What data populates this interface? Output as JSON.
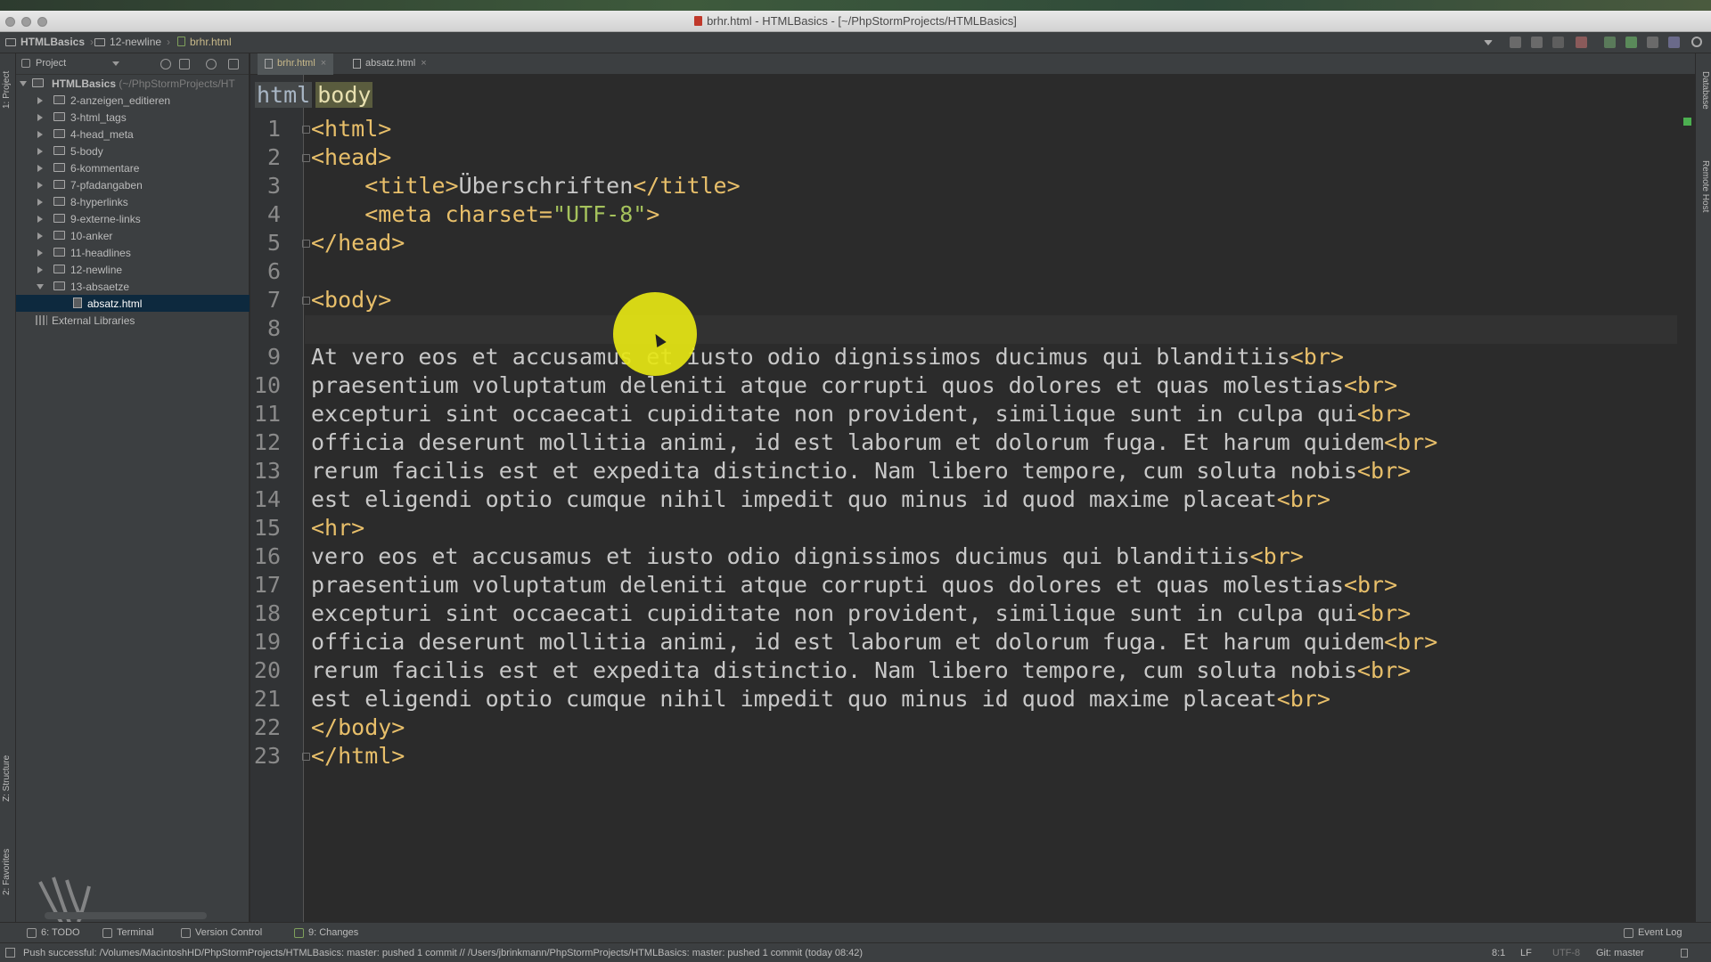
{
  "window": {
    "title": "brhr.html - HTMLBasics - [~/PhpStormProjects/HTMLBasics]"
  },
  "nav": {
    "crumbs": [
      "HTMLBasics",
      "12-newline",
      "brhr.html"
    ]
  },
  "side_tabs": {
    "project": "1: Project",
    "structure": "Z: Structure",
    "favorites": "2: Favorites",
    "database": "Database",
    "remote_host": "Remote Host"
  },
  "project_panel": {
    "title": "Project",
    "root": {
      "label": "HTMLBasics",
      "path": "(~/PhpStormProjects/HT"
    },
    "items": [
      {
        "label": "2-anzeigen_editieren"
      },
      {
        "label": "3-html_tags"
      },
      {
        "label": "4-head_meta"
      },
      {
        "label": "5-body"
      },
      {
        "label": "6-kommentare"
      },
      {
        "label": "7-pfadangaben"
      },
      {
        "label": "8-hyperlinks"
      },
      {
        "label": "9-externe-links"
      },
      {
        "label": "10-anker"
      },
      {
        "label": "11-headlines"
      },
      {
        "label": "12-newline"
      },
      {
        "label": "13-absaetze"
      }
    ],
    "child_file": "absatz.html",
    "external": "External Libraries"
  },
  "editor": {
    "tabs": [
      {
        "label": "brhr.html",
        "active": true
      },
      {
        "label": "absatz.html",
        "active": false
      }
    ],
    "crumbs": [
      "html",
      "body"
    ],
    "lines": [
      "<html>",
      "<head>",
      "    <title>Überschriften</title>",
      "    <meta charset=\"UTF-8\">",
      "</head>",
      "",
      "<body>",
      "",
      "At vero eos et accusamus et iusto odio dignissimos ducimus qui blanditiis<br>",
      "praesentium voluptatum deleniti atque corrupti quos dolores et quas molestias<br>",
      "excepturi sint occaecati cupiditate non provident, similique sunt in culpa qui<br>",
      "officia deserunt mollitia animi, id est laborum et dolorum fuga. Et harum quidem<br>",
      "rerum facilis est et expedita distinctio. Nam libero tempore, cum soluta nobis<br>",
      "est eligendi optio cumque nihil impedit quo minus id quod maxime placeat<br>",
      "<hr>",
      "vero eos et accusamus et iusto odio dignissimos ducimus qui blanditiis<br>",
      "praesentium voluptatum deleniti atque corrupti quos dolores et quas molestias<br>",
      "excepturi sint occaecati cupiditate non provident, similique sunt in culpa qui<br>",
      "officia deserunt mollitia animi, id est laborum et dolorum fuga. Et harum quidem<br>",
      "rerum facilis est et expedita distinctio. Nam libero tempore, cum soluta nobis<br>",
      "est eligendi optio cumque nihil impedit quo minus id quod maxime placeat<br>",
      "</body>",
      "</html>"
    ]
  },
  "tool_windows": {
    "todo": "6: TODO",
    "terminal": "Terminal",
    "vcs": "Version Control",
    "changes": "9: Changes",
    "event_log": "Event Log"
  },
  "status": {
    "message": "Push successful: /Volumes/MacintoshHD/PhpStormProjects/HTMLBasics: master: pushed 1 commit // /Users/jbrinkmann/PhpStormProjects/HTMLBasics: master: pushed 1 commit (today 08:42)",
    "position": "8:1",
    "line_sep": "LF",
    "encoding": "UTF-8",
    "git": "Git: master"
  },
  "colors": {
    "background": "#2b2b2b",
    "tag": "#e8bf6a",
    "string": "#a5c25c",
    "selection": "#0d293e",
    "cursor_highlight": "#e6e614"
  }
}
